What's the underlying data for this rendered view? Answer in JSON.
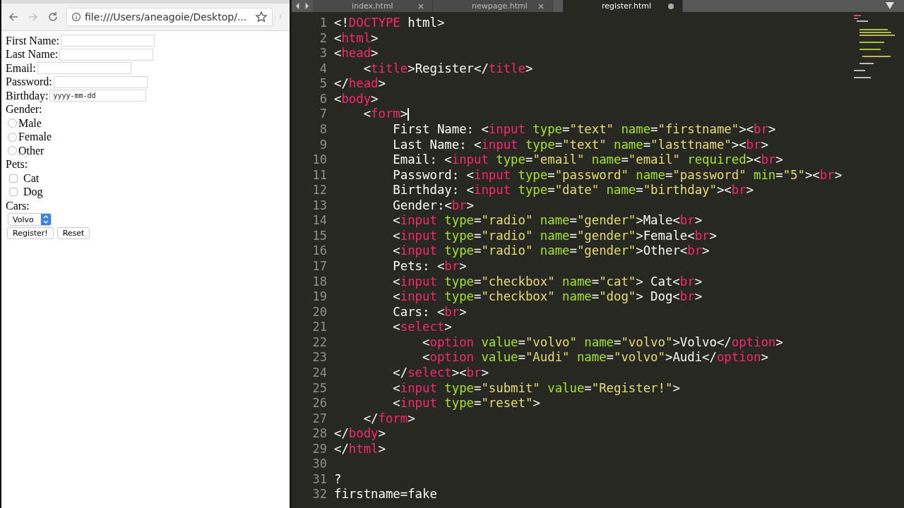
{
  "browser": {
    "url": "file:///Users/aneagoie/Desktop/...",
    "form": {
      "fields": [
        {
          "kind": "text",
          "label": "First Name:"
        },
        {
          "kind": "text",
          "label": "Last Name:"
        },
        {
          "kind": "text",
          "label": "Email:"
        },
        {
          "kind": "text",
          "label": "Password:"
        },
        {
          "kind": "date",
          "label": "Birthday:",
          "placeholder": "yyyy-mm-dd"
        }
      ],
      "gender_label": "Gender:",
      "gender_options": [
        {
          "label": "Male",
          "selected": false
        },
        {
          "label": "Female",
          "selected": false
        },
        {
          "label": "Other",
          "selected": false
        }
      ],
      "pets_label": "Pets:",
      "pets": [
        {
          "label": "Cat",
          "checked": false
        },
        {
          "label": "Dog",
          "checked": false
        }
      ],
      "cars_label": "Cars:",
      "car_select": {
        "value": "Volvo"
      },
      "buttons": [
        "Register!",
        "Reset"
      ]
    }
  },
  "editor": {
    "tabs": [
      {
        "label": "index.html",
        "selected": false,
        "modified": false
      },
      {
        "label": "newpage.html",
        "selected": false,
        "modified": false
      },
      {
        "label": "register.html",
        "selected": true,
        "modified": true
      }
    ],
    "lines": [
      {
        "number": "1",
        "tokens": [
          {
            "kind": "punct",
            "text": "<!"
          },
          {
            "kind": "tag",
            "text": "DOCTYPE"
          },
          {
            "kind": "punct",
            "text": " html>"
          }
        ]
      },
      {
        "number": "2",
        "tokens": [
          {
            "kind": "punct",
            "text": "<"
          },
          {
            "kind": "tag",
            "text": "html"
          },
          {
            "kind": "punct",
            "text": ">"
          }
        ]
      },
      {
        "number": "3",
        "tokens": [
          {
            "kind": "punct",
            "text": "<"
          },
          {
            "kind": "tag",
            "text": "head"
          },
          {
            "kind": "punct",
            "text": ">"
          }
        ]
      },
      {
        "number": "4",
        "tokens": [
          {
            "kind": "punct",
            "text": "    <"
          },
          {
            "kind": "tag",
            "text": "title"
          },
          {
            "kind": "punct",
            "text": ">Register</"
          },
          {
            "kind": "tag",
            "text": "title"
          },
          {
            "kind": "punct",
            "text": ">"
          }
        ]
      },
      {
        "number": "5",
        "tokens": [
          {
            "kind": "punct",
            "text": "</"
          },
          {
            "kind": "tag",
            "text": "head"
          },
          {
            "kind": "punct",
            "text": ">"
          }
        ]
      },
      {
        "number": "6",
        "tokens": [
          {
            "kind": "punct",
            "text": "<"
          },
          {
            "kind": "tag",
            "text": "body"
          },
          {
            "kind": "punct",
            "text": ">"
          }
        ]
      },
      {
        "number": "7",
        "cursor": true,
        "tokens": [
          {
            "kind": "punct",
            "text": "    <"
          },
          {
            "kind": "tag",
            "text": "form"
          },
          {
            "kind": "punct",
            "text": ">"
          }
        ]
      },
      {
        "number": "8",
        "tokens": [
          {
            "kind": "punct",
            "text": "        First Name: <"
          },
          {
            "kind": "tag",
            "text": "input"
          },
          {
            "kind": "attr",
            "text": " type"
          },
          {
            "kind": "punct",
            "text": "="
          },
          {
            "kind": "string",
            "text": "\"text\""
          },
          {
            "kind": "attr",
            "text": " name"
          },
          {
            "kind": "punct",
            "text": "="
          },
          {
            "kind": "string",
            "text": "\"firstname\""
          },
          {
            "kind": "punct",
            "text": "><"
          },
          {
            "kind": "tag",
            "text": "br"
          },
          {
            "kind": "punct",
            "text": ">"
          }
        ]
      },
      {
        "number": "9",
        "tokens": [
          {
            "kind": "punct",
            "text": "        Last Name: <"
          },
          {
            "kind": "tag",
            "text": "input"
          },
          {
            "kind": "attr",
            "text": " type"
          },
          {
            "kind": "punct",
            "text": "="
          },
          {
            "kind": "string",
            "text": "\"text\""
          },
          {
            "kind": "attr",
            "text": " name"
          },
          {
            "kind": "punct",
            "text": "="
          },
          {
            "kind": "string",
            "text": "\"lasttname\""
          },
          {
            "kind": "punct",
            "text": "><"
          },
          {
            "kind": "tag",
            "text": "br"
          },
          {
            "kind": "punct",
            "text": ">"
          }
        ]
      },
      {
        "number": "10",
        "tokens": [
          {
            "kind": "punct",
            "text": "        Email: <"
          },
          {
            "kind": "tag",
            "text": "input"
          },
          {
            "kind": "attr",
            "text": " type"
          },
          {
            "kind": "punct",
            "text": "="
          },
          {
            "kind": "string",
            "text": "\"email\""
          },
          {
            "kind": "attr",
            "text": " name"
          },
          {
            "kind": "punct",
            "text": "="
          },
          {
            "kind": "string",
            "text": "\"email\""
          },
          {
            "kind": "attr",
            "text": " required"
          },
          {
            "kind": "punct",
            "text": "><"
          },
          {
            "kind": "tag",
            "text": "br"
          },
          {
            "kind": "punct",
            "text": ">"
          }
        ]
      },
      {
        "number": "11",
        "tokens": [
          {
            "kind": "punct",
            "text": "        Password: <"
          },
          {
            "kind": "tag",
            "text": "input"
          },
          {
            "kind": "attr",
            "text": " type"
          },
          {
            "kind": "punct",
            "text": "="
          },
          {
            "kind": "string",
            "text": "\"password\""
          },
          {
            "kind": "attr",
            "text": " name"
          },
          {
            "kind": "punct",
            "text": "="
          },
          {
            "kind": "string",
            "text": "\"password\""
          },
          {
            "kind": "attr",
            "text": " min"
          },
          {
            "kind": "punct",
            "text": "="
          },
          {
            "kind": "string",
            "text": "\"5\""
          },
          {
            "kind": "punct",
            "text": "><"
          },
          {
            "kind": "tag",
            "text": "br"
          },
          {
            "kind": "punct",
            "text": ">"
          }
        ]
      },
      {
        "number": "12",
        "tokens": [
          {
            "kind": "punct",
            "text": "        Birthday: <"
          },
          {
            "kind": "tag",
            "text": "input"
          },
          {
            "kind": "attr",
            "text": " type"
          },
          {
            "kind": "punct",
            "text": "="
          },
          {
            "kind": "string",
            "text": "\"date\""
          },
          {
            "kind": "attr",
            "text": " name"
          },
          {
            "kind": "punct",
            "text": "="
          },
          {
            "kind": "string",
            "text": "\"birthday\""
          },
          {
            "kind": "punct",
            "text": "><"
          },
          {
            "kind": "tag",
            "text": "br"
          },
          {
            "kind": "punct",
            "text": ">"
          }
        ]
      },
      {
        "number": "13",
        "tokens": [
          {
            "kind": "punct",
            "text": "        Gender:<"
          },
          {
            "kind": "tag",
            "text": "br"
          },
          {
            "kind": "punct",
            "text": ">"
          }
        ]
      },
      {
        "number": "14",
        "tokens": [
          {
            "kind": "punct",
            "text": "        <"
          },
          {
            "kind": "tag",
            "text": "input"
          },
          {
            "kind": "attr",
            "text": " type"
          },
          {
            "kind": "punct",
            "text": "="
          },
          {
            "kind": "string",
            "text": "\"radio\""
          },
          {
            "kind": "attr",
            "text": " name"
          },
          {
            "kind": "punct",
            "text": "="
          },
          {
            "kind": "string",
            "text": "\"gender\""
          },
          {
            "kind": "punct",
            "text": ">Male<"
          },
          {
            "kind": "tag",
            "text": "br"
          },
          {
            "kind": "punct",
            "text": ">"
          }
        ]
      },
      {
        "number": "15",
        "tokens": [
          {
            "kind": "punct",
            "text": "        <"
          },
          {
            "kind": "tag",
            "text": "input"
          },
          {
            "kind": "attr",
            "text": " type"
          },
          {
            "kind": "punct",
            "text": "="
          },
          {
            "kind": "string",
            "text": "\"radio\""
          },
          {
            "kind": "attr",
            "text": " name"
          },
          {
            "kind": "punct",
            "text": "="
          },
          {
            "kind": "string",
            "text": "\"gender\""
          },
          {
            "kind": "punct",
            "text": ">Female<"
          },
          {
            "kind": "tag",
            "text": "br"
          },
          {
            "kind": "punct",
            "text": ">"
          }
        ]
      },
      {
        "number": "16",
        "tokens": [
          {
            "kind": "punct",
            "text": "        <"
          },
          {
            "kind": "tag",
            "text": "input"
          },
          {
            "kind": "attr",
            "text": " type"
          },
          {
            "kind": "punct",
            "text": "="
          },
          {
            "kind": "string",
            "text": "\"radio\""
          },
          {
            "kind": "attr",
            "text": " name"
          },
          {
            "kind": "punct",
            "text": "="
          },
          {
            "kind": "string",
            "text": "\"gender\""
          },
          {
            "kind": "punct",
            "text": ">Other<"
          },
          {
            "kind": "tag",
            "text": "br"
          },
          {
            "kind": "punct",
            "text": ">"
          }
        ]
      },
      {
        "number": "17",
        "tokens": [
          {
            "kind": "punct",
            "text": "        Pets: <"
          },
          {
            "kind": "tag",
            "text": "br"
          },
          {
            "kind": "punct",
            "text": ">"
          }
        ]
      },
      {
        "number": "18",
        "tokens": [
          {
            "kind": "punct",
            "text": "        <"
          },
          {
            "kind": "tag",
            "text": "input"
          },
          {
            "kind": "attr",
            "text": " type"
          },
          {
            "kind": "punct",
            "text": "="
          },
          {
            "kind": "string",
            "text": "\"checkbox\""
          },
          {
            "kind": "attr",
            "text": " name"
          },
          {
            "kind": "punct",
            "text": "="
          },
          {
            "kind": "string",
            "text": "\"cat\""
          },
          {
            "kind": "punct",
            "text": "> Cat<"
          },
          {
            "kind": "tag",
            "text": "br"
          },
          {
            "kind": "punct",
            "text": ">"
          }
        ]
      },
      {
        "number": "19",
        "tokens": [
          {
            "kind": "punct",
            "text": "        <"
          },
          {
            "kind": "tag",
            "text": "input"
          },
          {
            "kind": "attr",
            "text": " type"
          },
          {
            "kind": "punct",
            "text": "="
          },
          {
            "kind": "string",
            "text": "\"checkbox\""
          },
          {
            "kind": "attr",
            "text": " name"
          },
          {
            "kind": "punct",
            "text": "="
          },
          {
            "kind": "string",
            "text": "\"dog\""
          },
          {
            "kind": "punct",
            "text": "> Dog<"
          },
          {
            "kind": "tag",
            "text": "br"
          },
          {
            "kind": "punct",
            "text": ">"
          }
        ]
      },
      {
        "number": "20",
        "tokens": [
          {
            "kind": "punct",
            "text": "        Cars: <"
          },
          {
            "kind": "tag",
            "text": "br"
          },
          {
            "kind": "punct",
            "text": ">"
          }
        ]
      },
      {
        "number": "21",
        "tokens": [
          {
            "kind": "punct",
            "text": "        <"
          },
          {
            "kind": "tag",
            "text": "select"
          },
          {
            "kind": "punct",
            "text": ">"
          }
        ]
      },
      {
        "number": "22",
        "tokens": [
          {
            "kind": "punct",
            "text": "            <"
          },
          {
            "kind": "tag",
            "text": "option"
          },
          {
            "kind": "attr",
            "text": " value"
          },
          {
            "kind": "punct",
            "text": "="
          },
          {
            "kind": "string",
            "text": "\"volvo\""
          },
          {
            "kind": "attr",
            "text": " name"
          },
          {
            "kind": "punct",
            "text": "="
          },
          {
            "kind": "string",
            "text": "\"volvo\""
          },
          {
            "kind": "punct",
            "text": ">Volvo</"
          },
          {
            "kind": "tag",
            "text": "option"
          },
          {
            "kind": "punct",
            "text": ">"
          }
        ]
      },
      {
        "number": "23",
        "tokens": [
          {
            "kind": "punct",
            "text": "            <"
          },
          {
            "kind": "tag",
            "text": "option"
          },
          {
            "kind": "attr",
            "text": " value"
          },
          {
            "kind": "punct",
            "text": "="
          },
          {
            "kind": "string",
            "text": "\"Audi\""
          },
          {
            "kind": "attr",
            "text": " name"
          },
          {
            "kind": "punct",
            "text": "="
          },
          {
            "kind": "string",
            "text": "\"volvo\""
          },
          {
            "kind": "punct",
            "text": ">Audi</"
          },
          {
            "kind": "tag",
            "text": "option"
          },
          {
            "kind": "punct",
            "text": ">"
          }
        ]
      },
      {
        "number": "24",
        "tokens": [
          {
            "kind": "punct",
            "text": "        </"
          },
          {
            "kind": "tag",
            "text": "select"
          },
          {
            "kind": "punct",
            "text": "><"
          },
          {
            "kind": "tag",
            "text": "br"
          },
          {
            "kind": "punct",
            "text": ">"
          }
        ]
      },
      {
        "number": "25",
        "tokens": [
          {
            "kind": "punct",
            "text": "        <"
          },
          {
            "kind": "tag",
            "text": "input"
          },
          {
            "kind": "attr",
            "text": " type"
          },
          {
            "kind": "punct",
            "text": "="
          },
          {
            "kind": "string",
            "text": "\"submit\""
          },
          {
            "kind": "attr",
            "text": " value"
          },
          {
            "kind": "punct",
            "text": "="
          },
          {
            "kind": "string",
            "text": "\"Register!\""
          },
          {
            "kind": "punct",
            "text": ">"
          }
        ]
      },
      {
        "number": "26",
        "tokens": [
          {
            "kind": "punct",
            "text": "        <"
          },
          {
            "kind": "tag",
            "text": "input"
          },
          {
            "kind": "attr",
            "text": " type"
          },
          {
            "kind": "punct",
            "text": "="
          },
          {
            "kind": "string",
            "text": "\"reset\""
          },
          {
            "kind": "punct",
            "text": ">"
          }
        ]
      },
      {
        "number": "27",
        "tokens": [
          {
            "kind": "punct",
            "text": "    </"
          },
          {
            "kind": "tag",
            "text": "form"
          },
          {
            "kind": "punct",
            "text": ">"
          }
        ]
      },
      {
        "number": "28",
        "tokens": [
          {
            "kind": "punct",
            "text": "</"
          },
          {
            "kind": "tag",
            "text": "body"
          },
          {
            "kind": "punct",
            "text": ">"
          }
        ]
      },
      {
        "number": "29",
        "tokens": [
          {
            "kind": "punct",
            "text": "</"
          },
          {
            "kind": "tag",
            "text": "html"
          },
          {
            "kind": "punct",
            "text": ">"
          }
        ]
      },
      {
        "number": "30"
      },
      {
        "number": "31",
        "tokens": [
          {
            "kind": "punct",
            "text": "?"
          }
        ]
      },
      {
        "number": "32",
        "tokens": [
          {
            "kind": "punct",
            "text": "firstname=fake"
          }
        ]
      }
    ]
  }
}
